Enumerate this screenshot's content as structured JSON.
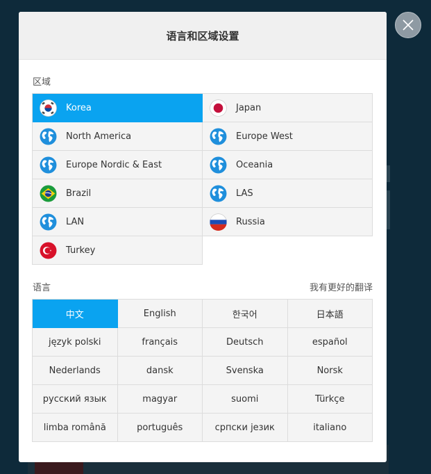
{
  "dialog": {
    "title": "语言和区域设置",
    "close_icon": "close-icon"
  },
  "region": {
    "label": "区域",
    "selected": "Korea",
    "items": [
      {
        "label": "Korea",
        "icon": "korea-flag-icon",
        "selected": true
      },
      {
        "label": "Japan",
        "icon": "japan-flag-icon",
        "selected": false
      },
      {
        "label": "North America",
        "icon": "globe-icon",
        "selected": false
      },
      {
        "label": "Europe West",
        "icon": "globe-icon",
        "selected": false
      },
      {
        "label": "Europe Nordic & East",
        "icon": "globe-icon",
        "selected": false
      },
      {
        "label": "Oceania",
        "icon": "globe-icon",
        "selected": false
      },
      {
        "label": "Brazil",
        "icon": "brazil-flag-icon",
        "selected": false
      },
      {
        "label": "LAS",
        "icon": "globe-icon",
        "selected": false
      },
      {
        "label": "LAN",
        "icon": "globe-icon",
        "selected": false
      },
      {
        "label": "Russia",
        "icon": "russia-flag-icon",
        "selected": false
      },
      {
        "label": "Turkey",
        "icon": "turkey-flag-icon",
        "selected": false
      }
    ]
  },
  "language": {
    "label": "语言",
    "better_translation_link": "我有更好的翻译",
    "selected": "中文",
    "items": [
      {
        "label": "中文",
        "selected": true
      },
      {
        "label": "English",
        "selected": false
      },
      {
        "label": "한국어",
        "selected": false
      },
      {
        "label": "日本語",
        "selected": false
      },
      {
        "label": "język polski",
        "selected": false
      },
      {
        "label": "français",
        "selected": false
      },
      {
        "label": "Deutsch",
        "selected": false
      },
      {
        "label": "español",
        "selected": false
      },
      {
        "label": "Nederlands",
        "selected": false
      },
      {
        "label": "dansk",
        "selected": false
      },
      {
        "label": "Svenska",
        "selected": false
      },
      {
        "label": "Norsk",
        "selected": false
      },
      {
        "label": "русский язык",
        "selected": false
      },
      {
        "label": "magyar",
        "selected": false
      },
      {
        "label": "suomi",
        "selected": false
      },
      {
        "label": "Türkçe",
        "selected": false
      },
      {
        "label": "limba română",
        "selected": false
      },
      {
        "label": "português",
        "selected": false
      },
      {
        "label": "српски језик",
        "selected": false
      },
      {
        "label": "italiano",
        "selected": false
      }
    ]
  },
  "colors": {
    "accent": "#0aa3f0",
    "overlay_bg": "#0e2a3a",
    "cell_bg": "#f4f4f4",
    "header_bg": "#f0f0f0"
  }
}
